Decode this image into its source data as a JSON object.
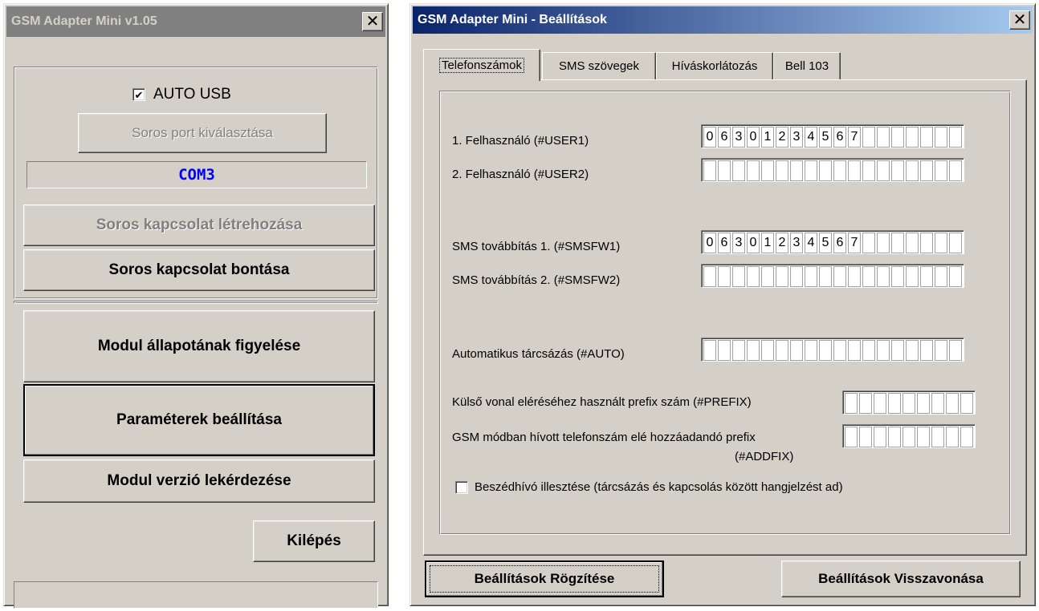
{
  "left_window": {
    "title": "GSM Adapter Mini v1.05",
    "auto_usb_label": "AUTO USB",
    "auto_usb_checked": true,
    "select_port_label": "Soros port kiválasztása",
    "com_port": "COM3",
    "connect_label": "Soros kapcsolat létrehozása",
    "disconnect_label": "Soros kapcsolat bontása",
    "monitor_label": "Modul állapotának figyelése",
    "params_label": "Paraméterek beállítása",
    "version_label": "Modul verzió lekérdezése",
    "exit_label": "Kilépés",
    "status_text": ""
  },
  "right_window": {
    "title": "GSM Adapter Mini  -  Beállítások",
    "tabs": [
      {
        "label": "Telefonszámok",
        "active": true
      },
      {
        "label": "SMS szövegek",
        "active": false
      },
      {
        "label": "Híváskorlátozás",
        "active": false
      },
      {
        "label": "Bell 103",
        "active": false
      }
    ],
    "fields": {
      "user1": {
        "label": "1. Felhasználó  (#USER1)",
        "digits": [
          "0",
          "6",
          "3",
          "0",
          "1",
          "2",
          "3",
          "4",
          "5",
          "6",
          "7",
          "",
          "",
          "",
          "",
          "",
          "",
          ""
        ]
      },
      "user2": {
        "label": "2. Felhasználó  (#USER2)",
        "digits": [
          "",
          "",
          "",
          "",
          "",
          "",
          "",
          "",
          "",
          "",
          "",
          "",
          "",
          "",
          "",
          "",
          "",
          ""
        ]
      },
      "smsfw1": {
        "label": "SMS továbbítás 1.  (#SMSFW1)",
        "digits": [
          "0",
          "6",
          "3",
          "0",
          "1",
          "2",
          "3",
          "4",
          "5",
          "6",
          "7",
          "",
          "",
          "",
          "",
          "",
          "",
          ""
        ]
      },
      "smsfw2": {
        "label": "SMS továbbítás 2.  (#SMSFW2)",
        "digits": [
          "",
          "",
          "",
          "",
          "",
          "",
          "",
          "",
          "",
          "",
          "",
          "",
          "",
          "",
          "",
          "",
          "",
          ""
        ]
      },
      "auto": {
        "label": "Automatikus tárcsázás (#AUTO)",
        "digits": [
          "",
          "",
          "",
          "",
          "",
          "",
          "",
          "",
          "",
          "",
          "",
          "",
          "",
          "",
          "",
          "",
          "",
          ""
        ]
      },
      "prefix": {
        "label": "Külső vonal eléréséhez használt prefix szám (#PREFIX)",
        "digits": [
          "",
          "",
          "",
          "",
          "",
          "",
          "",
          "",
          ""
        ]
      },
      "addfix": {
        "label": "GSM módban hívott telefonszám elé hozzáadandó prefix",
        "label2": "(#ADDFIX)",
        "digits": [
          "",
          "",
          "",
          "",
          "",
          "",
          "",
          "",
          ""
        ]
      }
    },
    "speech_label": "Beszédhívó illesztése (tárcsázás és kapcsolás között hangjelzést ad)",
    "speech_checked": false,
    "save_label": "Beállítások Rögzítése",
    "revert_label": "Beállítások Visszavonása"
  }
}
